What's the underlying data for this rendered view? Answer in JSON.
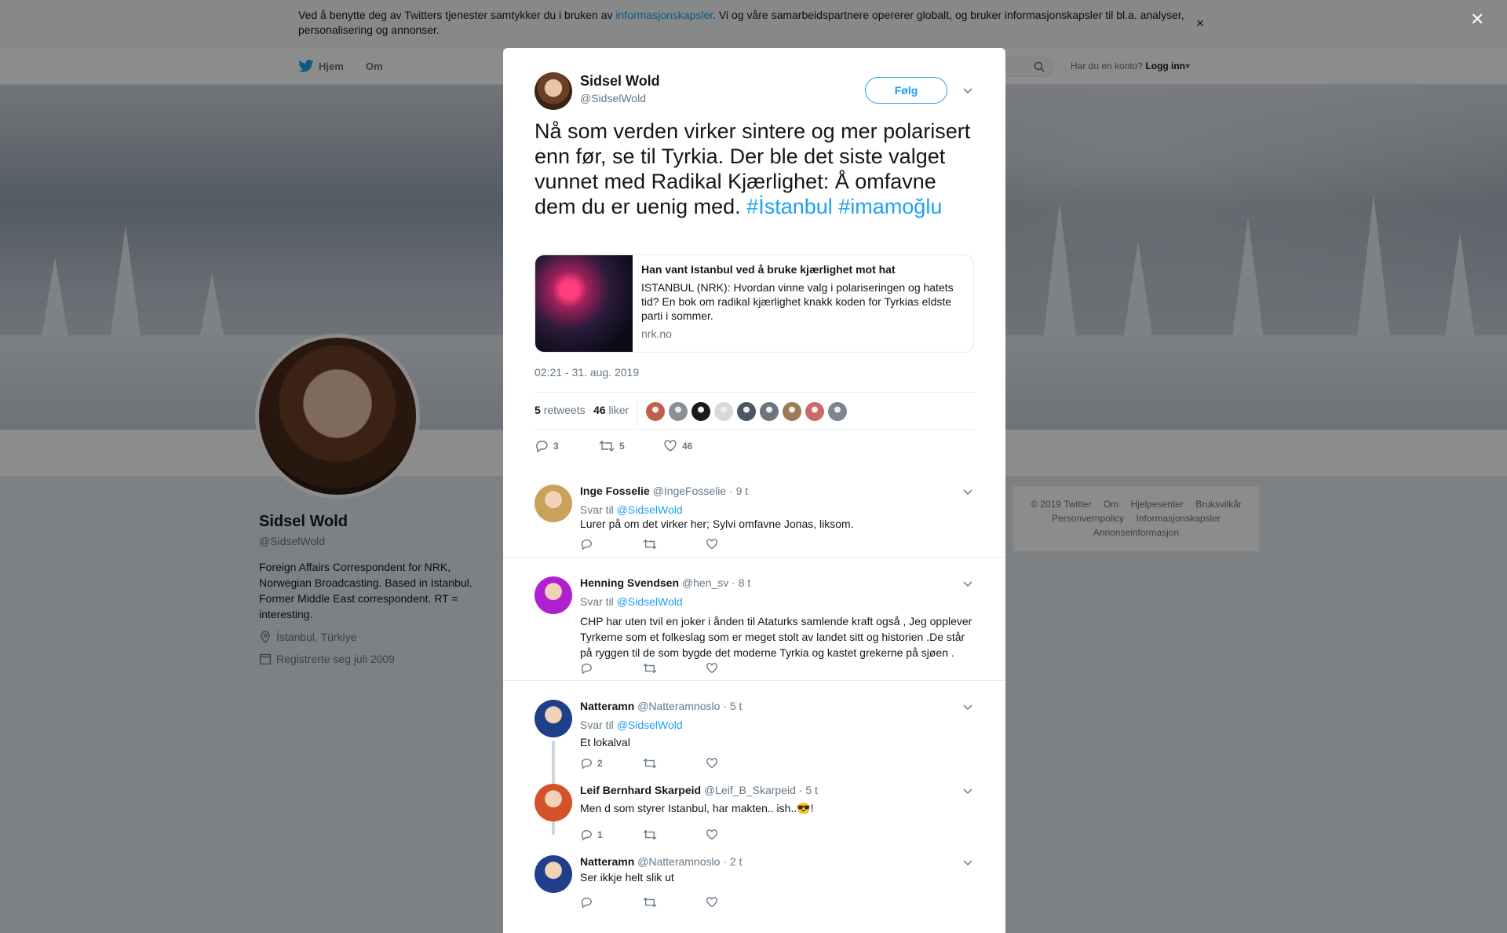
{
  "cookie": {
    "text_pre": "Ved å benytte deg av Twitters tjenester samtykker du i bruken av ",
    "link": "informasjonskapsler",
    "text_post": ". Vi og våre samarbeidspartnere opererer globalt, og bruker informasjonskapsler til bl.a. analyser, personalisering og annonser.",
    "close": "×"
  },
  "nav": {
    "home": "Hjem",
    "about": "Om",
    "login_prompt": "Har du en konto?",
    "login": "Logg inn"
  },
  "profile": {
    "name": "Sidsel Wold",
    "handle": "@SidselWold",
    "bio": "Foreign Affairs Correspondent for NRK, Norwegian Broadcasting. Based in Istanbul. Former Middle East correspondent. RT = interesting.",
    "location": "İstanbul, Türkiye",
    "joined": "Registrerte seg juli 2009"
  },
  "footer": {
    "links": [
      "© 2019 Twitter",
      "Om",
      "Hjelpesenter",
      "Bruksvilkår",
      "Personvernpolicy",
      "Informasjonskapsler",
      "Annonseinformasjon"
    ]
  },
  "overlay_close": "×",
  "tweet": {
    "name": "Sidsel Wold",
    "handle": "@SidselWold",
    "follow": "Følg",
    "text": "Nå som verden virker sintere og mer polarisert enn før, se til Tyrkia. Der ble det siste valget vunnet med Radikal Kjærlighet: Å omfavne dem du er uenig med. ",
    "tag1": "#İstanbul",
    "tag2": "#imamoğlu",
    "card": {
      "title": "Han vant Istanbul ved å bruke kjærlighet mot hat",
      "description": "ISTANBUL (NRK): Hvordan vinne valg i polariseringen og hatets tid? En bok om radikal kjærlighet knakk koden for Tyrkias eldste parti i sommer.",
      "domain": "nrk.no"
    },
    "timestamp": "02:21 - 31. aug. 2019",
    "retweets_count": "5",
    "retweets_label": "retweets",
    "likes_count": "46",
    "likes_label": "liker",
    "liker_colors": [
      "#c0604a",
      "#8a8f96",
      "#1a1a1a",
      "#d9d9d9",
      "#4a5565",
      "#6c7480",
      "#9b7b5a",
      "#c96a6a",
      "#7a8590"
    ],
    "reply_count": "3",
    "retweet_count": "5",
    "like_count": "46"
  },
  "replies": [
    {
      "name": "Inge Fosselie",
      "handle": "@IngeFosselie",
      "time": "· 9 t",
      "reply_to_label": "Svar til",
      "reply_to": "@SidselWold",
      "body": "Lurer på om det virker her; Sylvi omfavne Jonas, liksom.",
      "reply_count": "",
      "avatar_color": "#c8a25a"
    },
    {
      "name": "Henning Svendsen",
      "handle": "@hen_sv",
      "time": "· 8 t",
      "reply_to_label": "Svar til",
      "reply_to": "@SidselWold",
      "body": "CHP har uten tvil en joker i ånden til Ataturks samlende kraft også , Jeg opplever Tyrkerne som et folkeslag som er meget stolt av landet sitt og historien .De står på ryggen til de som bygde det moderne Tyrkia og kastet grekerne på sjøen .",
      "reply_count": "",
      "avatar_color": "#b01fd0"
    },
    {
      "name": "Natteramn",
      "handle": "@Natteramnoslo",
      "time": "· 5 t",
      "reply_to_label": "Svar til",
      "reply_to": "@SidselWold",
      "body": "Et lokalval",
      "reply_count": "2",
      "avatar_color": "#1f3f8a"
    },
    {
      "name": "Leif Bernhard Skarpeid",
      "handle": "@Leif_B_Skarpeid",
      "time": "· 5 t",
      "body": "Men d som styrer Istanbul, har makten.. ish..😎!",
      "reply_count": "1",
      "avatar_color": "#d4522a"
    },
    {
      "name": "Natteramn",
      "handle": "@Natteramnoslo",
      "time": "· 2 t",
      "body": "Ser ikkje helt slik ut",
      "reply_count": "",
      "avatar_color": "#1f3f8a"
    }
  ]
}
